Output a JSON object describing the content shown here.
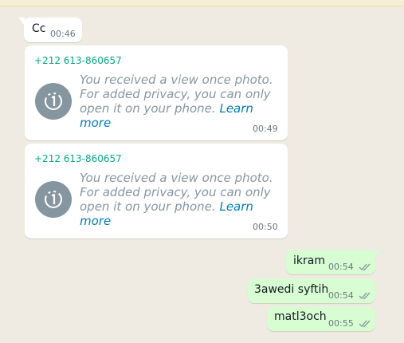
{
  "messages": [
    {
      "id": "m1",
      "type": "text",
      "direction": "in",
      "text": "Cc",
      "time": "00:46"
    },
    {
      "id": "m2",
      "type": "view_once",
      "direction": "in",
      "sender": "+212 613-860657",
      "line1": "You received a view once photo.",
      "line2": "For added privacy, you can only",
      "line3": "open it on your phone.",
      "link1": "Learn",
      "link2": "more",
      "time": "00:49"
    },
    {
      "id": "m3",
      "type": "view_once",
      "direction": "in",
      "sender": "+212 613-860657",
      "line1": "You received a view once photo.",
      "line2": "For added privacy, you can only",
      "line3": "open it on your phone.",
      "link1": "Learn",
      "link2": "more",
      "time": "00:50"
    },
    {
      "id": "m4",
      "type": "text",
      "direction": "out",
      "text": "ikram",
      "time": "00:54",
      "status": "read"
    },
    {
      "id": "m5",
      "type": "text",
      "direction": "out",
      "text": "3awedi syftih",
      "time": "00:54",
      "status": "read"
    },
    {
      "id": "m6",
      "type": "text",
      "direction": "out",
      "text": "matl3och",
      "time": "00:55",
      "status": "read"
    }
  ],
  "colors": {
    "background": "#efeae2",
    "incoming": "#ffffff",
    "outgoing": "#d9fdd3",
    "sender": "#06a885",
    "link": "#027eb5",
    "ticks": "#8696a0"
  },
  "icons": {
    "view_once": "view-once-icon",
    "status": "double-check-icon"
  }
}
